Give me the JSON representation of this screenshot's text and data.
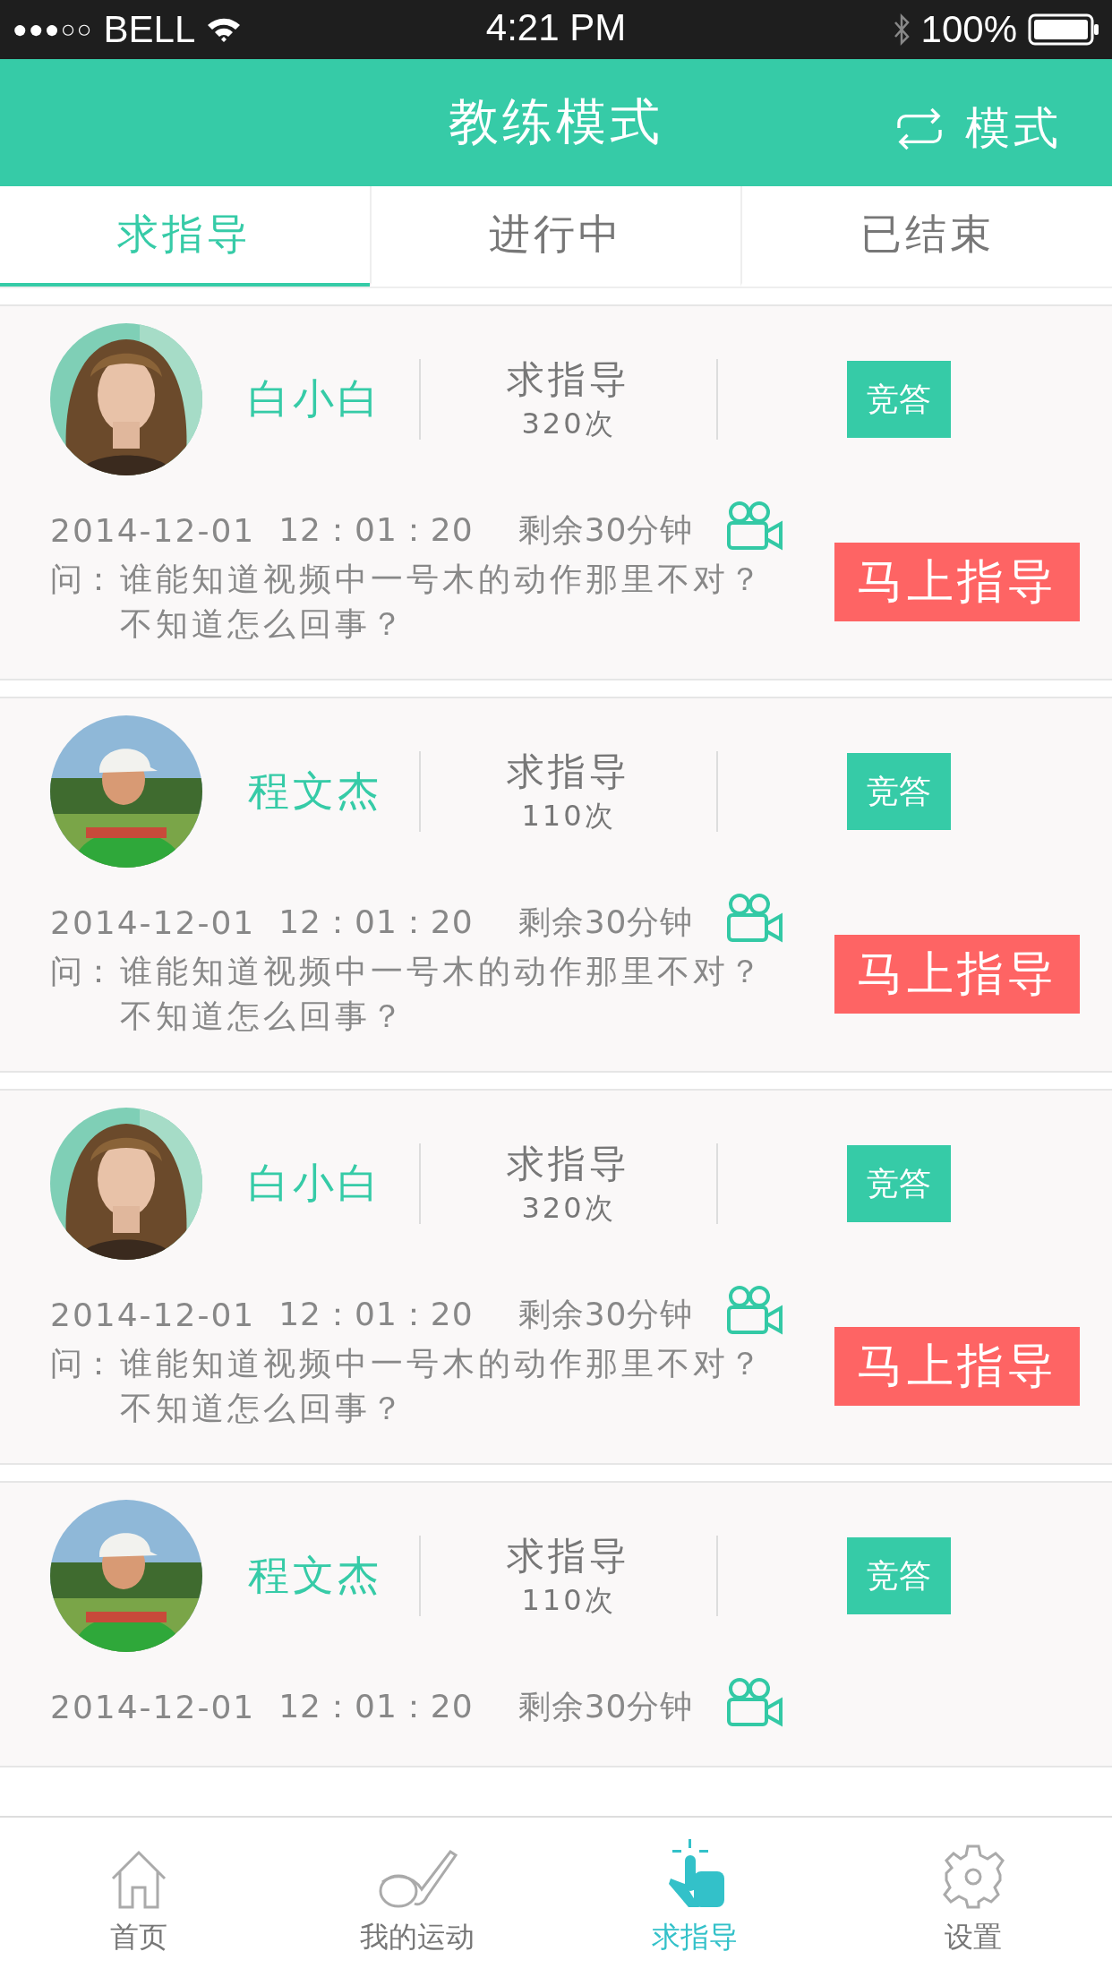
{
  "status_bar": {
    "signal": "●●●○○",
    "carrier": "BELL",
    "time": "4:21 PM",
    "battery": "100%"
  },
  "header": {
    "title": "教练模式",
    "mode_button": "模式"
  },
  "tabs": [
    {
      "label": "求指导",
      "selected": true
    },
    {
      "label": "进行中",
      "selected": false
    },
    {
      "label": "已结束",
      "selected": false
    }
  ],
  "cards": [
    {
      "name": "白小白",
      "request_label": "求指导",
      "count": "320次",
      "bid_button": "竞答",
      "date": "2014-12-01",
      "time": "12：01：20",
      "remaining": "剩余30分钟",
      "question_prefix": "问：",
      "question": "谁能知道视频中一号木的动作那里不对？不知道怎么回事？",
      "action_button": "马上指导"
    },
    {
      "name": "程文杰",
      "request_label": "求指导",
      "count": "110次",
      "bid_button": "竞答",
      "date": "2014-12-01",
      "time": "12：01：20",
      "remaining": "剩余30分钟",
      "question_prefix": "问：",
      "question": "谁能知道视频中一号木的动作那里不对？不知道怎么回事？",
      "action_button": "马上指导"
    },
    {
      "name": "白小白",
      "request_label": "求指导",
      "count": "320次",
      "bid_button": "竞答",
      "date": "2014-12-01",
      "time": "12：01：20",
      "remaining": "剩余30分钟",
      "question_prefix": "问：",
      "question": "谁能知道视频中一号木的动作那里不对？不知道怎么回事？",
      "action_button": "马上指导"
    },
    {
      "name": "程文杰",
      "request_label": "求指导",
      "count": "110次",
      "bid_button": "竞答",
      "date": "2014-12-01",
      "time": "12：01：20",
      "remaining": "剩余30分钟"
    }
  ],
  "tab_bar": [
    {
      "kind": "home",
      "label": "首页",
      "selected": false
    },
    {
      "kind": "sport",
      "label": "我的运动",
      "selected": false
    },
    {
      "kind": "guide",
      "label": "求指导",
      "selected": true
    },
    {
      "kind": "settings",
      "label": "设置",
      "selected": false
    }
  ]
}
